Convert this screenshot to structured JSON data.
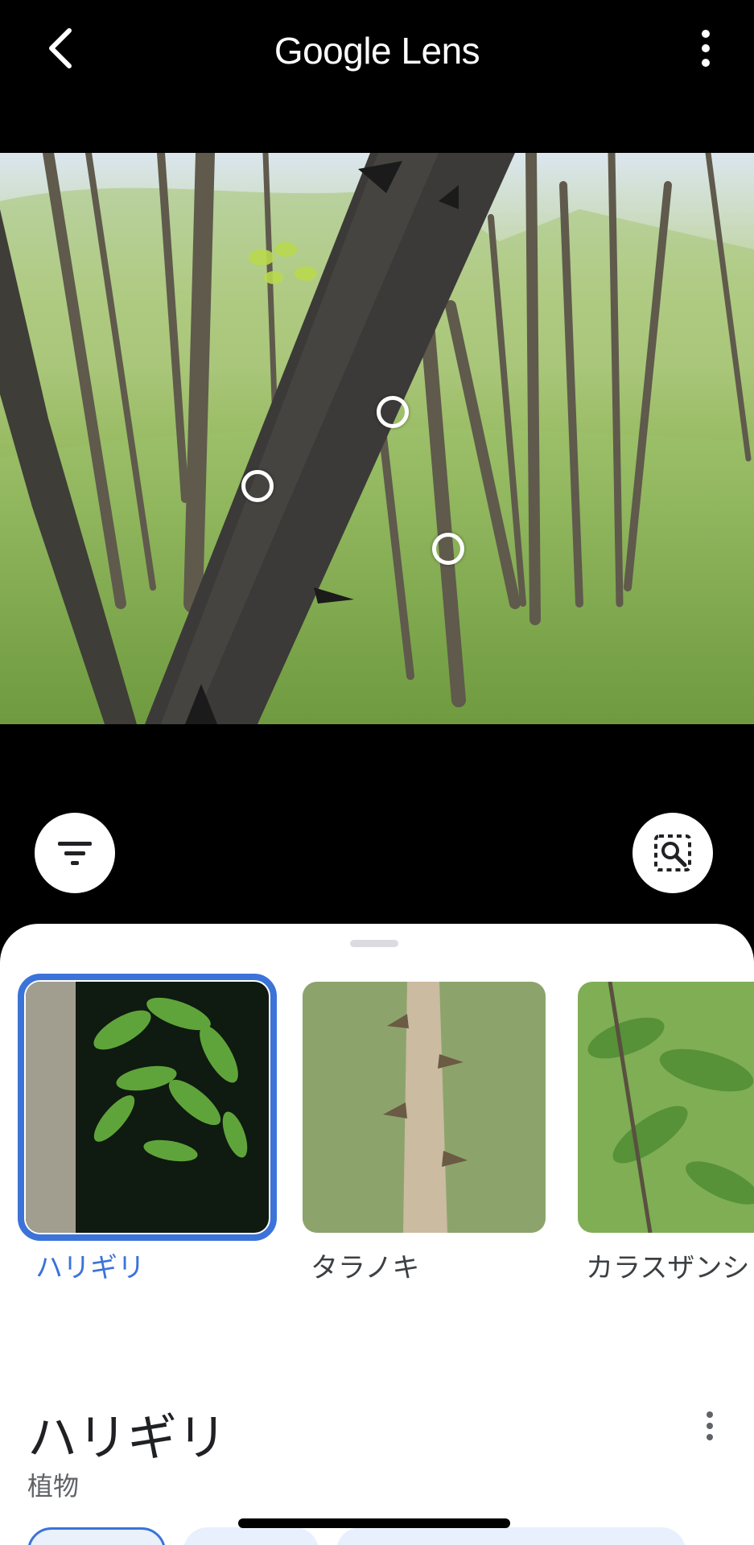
{
  "header": {
    "title": "Google Lens",
    "back_icon": "back-arrow-icon",
    "menu_icon": "more-vert-icon"
  },
  "photo": {
    "description_icon": "forest-photo"
  },
  "controls": {
    "filter_icon": "filter-icon",
    "search_region_icon": "image-search-icon"
  },
  "results": {
    "cards": [
      {
        "label": "ハリギリ",
        "selected": true
      },
      {
        "label": "タラノキ",
        "selected": false
      },
      {
        "label": "カラスザンシ",
        "selected": false
      }
    ],
    "detail": {
      "title": "ハリギリ",
      "subtitle": "植物"
    }
  },
  "colors": {
    "accent": "#3b73d9",
    "background": "#000000",
    "sheet": "#ffffff"
  }
}
